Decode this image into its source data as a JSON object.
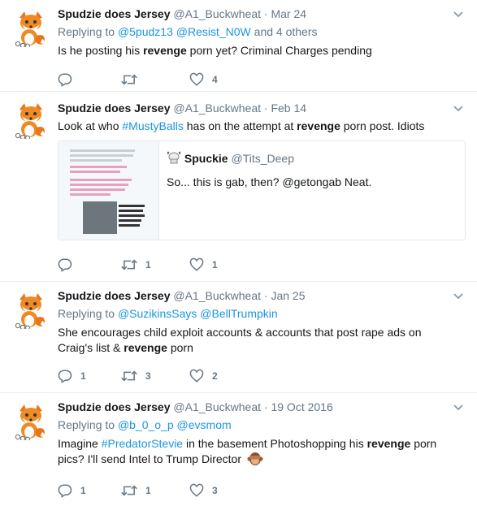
{
  "tweets": [
    {
      "name": "Spudzie does Jersey",
      "handle": "@A1_Buckwheat",
      "sep": "·",
      "time": "Mar 24",
      "replying_prefix": "Replying to",
      "replying_users": [
        "@5pudz13",
        "@Resist_N0W"
      ],
      "replying_suffix": "and 4 others",
      "text_parts": [
        "Is he posting his ",
        "revenge",
        " porn yet? Criminal Charges pending"
      ],
      "counts": {
        "reply": "",
        "retweet": "",
        "like": "4"
      }
    },
    {
      "name": "Spudzie does Jersey",
      "handle": "@A1_Buckwheat",
      "sep": "·",
      "time": "Feb 14",
      "text_parts": [
        "Look at who ",
        "#MustyBalls",
        " has on the attempt at ",
        "revenge",
        " porn post. Idiots"
      ],
      "quote": {
        "name": "Spuckie",
        "handle": "@Tits_Deep",
        "text": "So... this is gab, then? @getongab  Neat."
      },
      "counts": {
        "reply": "",
        "retweet": "1",
        "like": "1"
      }
    },
    {
      "name": "Spudzie does Jersey",
      "handle": "@A1_Buckwheat",
      "sep": "·",
      "time": "Jan 25",
      "replying_prefix": "Replying to",
      "replying_users": [
        "@SuzikinsSays",
        "@BellTrumpkin"
      ],
      "text_parts": [
        "She encourages child exploit accounts & accounts that post rape ads on Craig's list & ",
        "revenge",
        " porn"
      ],
      "counts": {
        "reply": "1",
        "retweet": "3",
        "like": "2"
      }
    },
    {
      "name": "Spudzie does Jersey",
      "handle": "@A1_Buckwheat",
      "sep": "·",
      "time": "19 Oct 2016",
      "replying_prefix": "Replying to",
      "replying_users": [
        "@b_0_o_p",
        "@evsmom"
      ],
      "text_parts": [
        "Imagine ",
        "#PredatorStevie",
        " in the basement Photoshopping his ",
        "revenge",
        " porn pics? I'll send Intel to Trump Director "
      ],
      "counts": {
        "reply": "1",
        "retweet": "1",
        "like": "3"
      }
    }
  ],
  "colors": {
    "link": "#1b95e0",
    "muted": "#657786",
    "border": "#e6ecf0",
    "text": "#14171a"
  },
  "icons": [
    "fox-avatar-icon",
    "chevron-down-icon",
    "reply-icon",
    "retweet-icon",
    "like-heart-icon",
    "goat-icon",
    "see-no-evil-monkey-icon"
  ]
}
